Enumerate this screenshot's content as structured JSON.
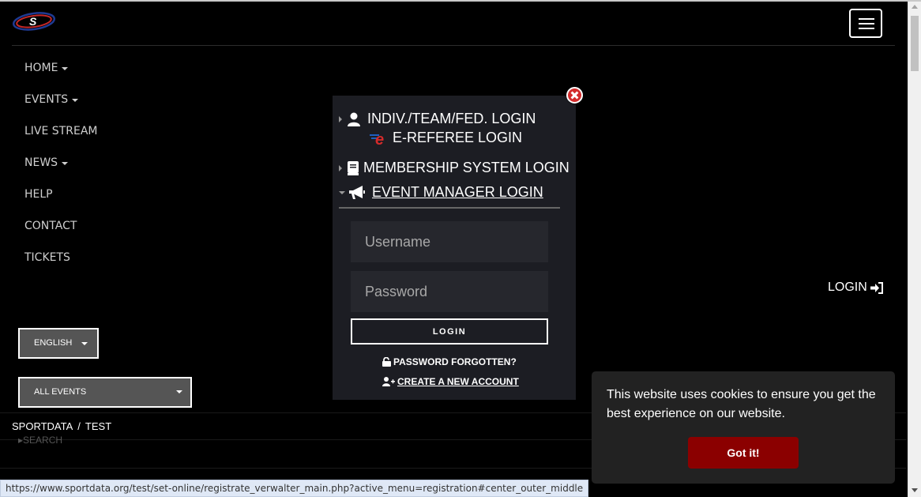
{
  "colors": {
    "accent_red": "#8b0000",
    "modal_bg": "#1c1d23",
    "close_red": "#d32b2b"
  },
  "header": {
    "logo_icon": "sportdata-logo-icon",
    "menu_icon": "hamburger-menu-icon"
  },
  "nav": {
    "items": [
      {
        "label": "HOME",
        "has_caret": true
      },
      {
        "label": "EVENTS",
        "has_caret": true
      },
      {
        "label": "LIVE STREAM",
        "has_caret": false
      },
      {
        "label": "NEWS",
        "has_caret": true
      },
      {
        "label": "HELP",
        "has_caret": false
      },
      {
        "label": "CONTACT",
        "has_caret": false
      },
      {
        "label": "TICKETS",
        "has_caret": false
      }
    ]
  },
  "login_link": {
    "label": "LOGIN",
    "icon": "sign-in-icon"
  },
  "language_select": {
    "value": "ENGLISH"
  },
  "events_select": {
    "value": "ALL EVENTS"
  },
  "breadcrumb": {
    "root": "SPORTDATA",
    "separator": "/",
    "current": "TEST"
  },
  "search_ghost": "SEARCH",
  "status_url": "https://www.sportdata.org/test/set-online/registrate_verwalter_main.php?active_menu=registration#center_outer_middle",
  "login_modal": {
    "options": {
      "indiv": "INDIV./TEAM/FED. LOGIN",
      "ereferee": "E-REFEREE LOGIN",
      "membership": "MEMBERSHIP SYSTEM LOGIN",
      "event_manager": "EVENT MANAGER LOGIN"
    },
    "username_placeholder": "Username",
    "password_placeholder": "Password",
    "login_button": "LOGIN",
    "password_forgotten": "PASSWORD FORGOTTEN?",
    "create_account": "CREATE A NEW ACCOUNT"
  },
  "cookie_banner": {
    "text": "This website uses cookies to ensure you get the best experience on our website.",
    "button": "Got it!"
  }
}
